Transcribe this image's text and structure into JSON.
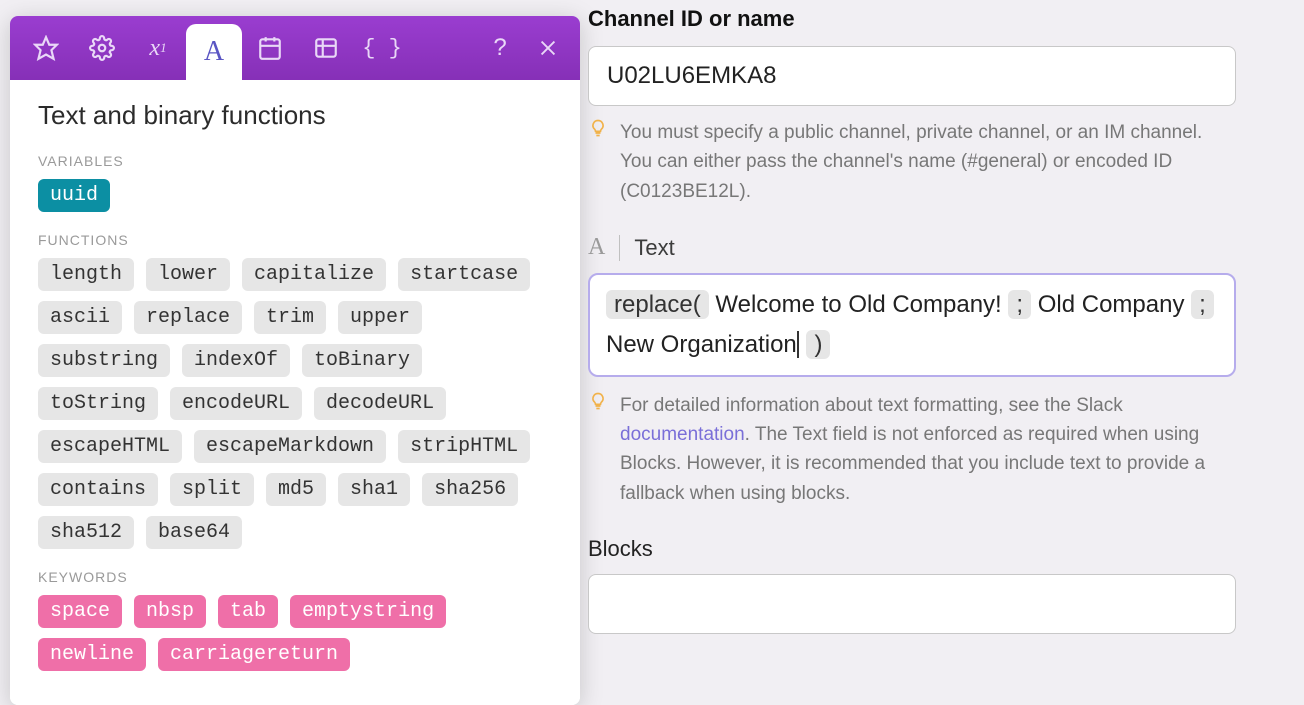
{
  "panel": {
    "title": "Text and binary functions",
    "sections": {
      "variables_label": "VARIABLES",
      "functions_label": "FUNCTIONS",
      "keywords_label": "KEYWORDS"
    },
    "variables": [
      "uuid"
    ],
    "functions": [
      "length",
      "lower",
      "capitalize",
      "startcase",
      "ascii",
      "replace",
      "trim",
      "upper",
      "substring",
      "indexOf",
      "toBinary",
      "toString",
      "encodeURL",
      "decodeURL",
      "escapeHTML",
      "escapeMarkdown",
      "stripHTML",
      "contains",
      "split",
      "md5",
      "sha1",
      "sha256",
      "sha512",
      "base64"
    ],
    "keywords": [
      "space",
      "nbsp",
      "tab",
      "emptystring",
      "newline",
      "carriagereturn"
    ]
  },
  "form": {
    "channel": {
      "label": "Channel ID or name",
      "value": "U02LU6EMKA8",
      "hint": "You must specify a public channel, private channel, or an IM channel. You can either pass the channel's name (#general) or encoded ID (C0123BE12L)."
    },
    "text": {
      "icon_label": "A",
      "label": "Text",
      "expr": {
        "tok_open": "replace(",
        "part1": " Welcome to Old Company! ",
        "tok_sep1": ";",
        "part2": " Old Company ",
        "tok_sep2": ";",
        "part3": " New Organization",
        "tok_close": ")"
      },
      "hint_prefix": "For detailed information about text formatting, see the Slack ",
      "hint_link": "documentation",
      "hint_suffix": ". The Text field is not enforced as required when using Blocks. However, it is recommended that you include text to provide a fallback when using blocks."
    },
    "blocks": {
      "label": "Blocks"
    }
  }
}
